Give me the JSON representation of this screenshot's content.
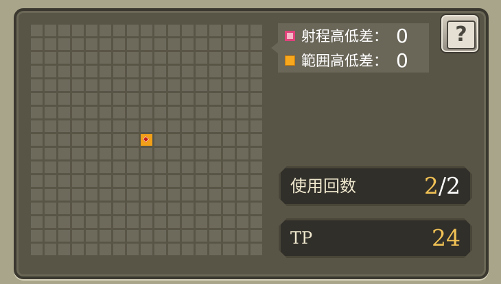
{
  "legend": {
    "range_height_label": "射程高低差：",
    "range_height_value": "0",
    "area_height_label": "範囲高低差：",
    "area_height_value": "0",
    "range_color": "#e0427b",
    "area_color": "#f8a81d"
  },
  "grid": {
    "columns": 17,
    "rows": 17,
    "selected_col": 8,
    "selected_row": 8
  },
  "help": {
    "icon": "help-book-icon",
    "glyph": "?"
  },
  "uses": {
    "label": "使用回数",
    "current": "2",
    "separator": "/",
    "max": "2"
  },
  "tp": {
    "label": "TP",
    "value": "24"
  }
}
